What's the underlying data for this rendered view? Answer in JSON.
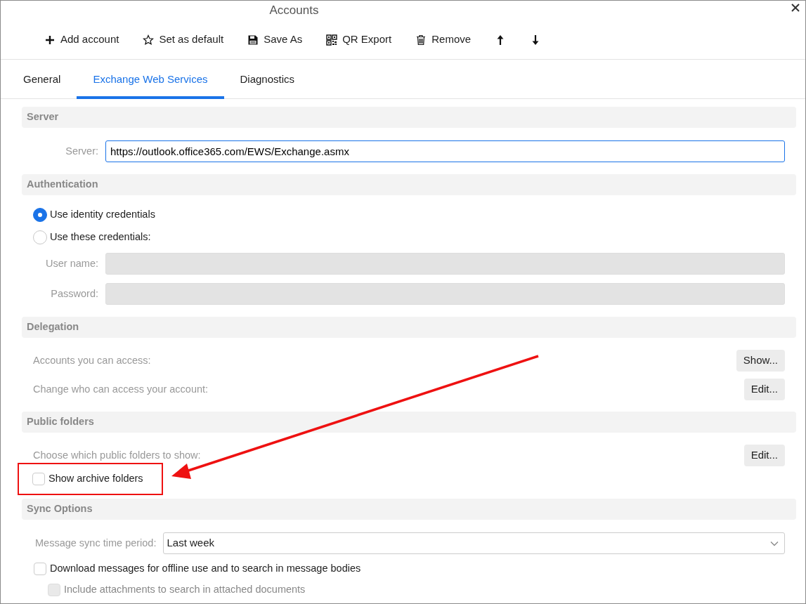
{
  "window": {
    "title": "Accounts"
  },
  "toolbar": [
    {
      "kind": "add",
      "label": "Add account"
    },
    {
      "kind": "default",
      "label": "Set as default"
    },
    {
      "kind": "save",
      "label": "Save As"
    },
    {
      "kind": "export",
      "label": "QR Export"
    },
    {
      "kind": "remove",
      "label": "Remove"
    },
    {
      "kind": "up"
    },
    {
      "kind": "down"
    }
  ],
  "tabs": [
    {
      "label": "General",
      "selected": false
    },
    {
      "label": "Exchange Web Services",
      "selected": true
    },
    {
      "label": "Diagnostics",
      "selected": false
    }
  ],
  "sections": [
    {
      "title": "Server",
      "rows": [
        {
          "kind": "field",
          "label": "Server:",
          "value": "https://outlook.office365.com/EWS/Exchange.asmx",
          "disabled": false,
          "focused": true
        }
      ]
    },
    {
      "title": "Authentication",
      "rows": [
        {
          "kind": "radio",
          "label": "Use identity credentials",
          "selected": true
        },
        {
          "kind": "radio",
          "label": "Use these credentials:",
          "selected": false
        },
        {
          "kind": "field",
          "label": "User name:",
          "disabled": true
        },
        {
          "kind": "field",
          "label": "Password:",
          "disabled": true
        }
      ]
    },
    {
      "title": "Delegation",
      "rows": [
        {
          "kind": "action",
          "label": "Accounts you can access:",
          "button": "Show..."
        },
        {
          "kind": "action",
          "label": "Change who can access your account:",
          "button": "Edit..."
        }
      ]
    },
    {
      "title": "Public folders",
      "rows": [
        {
          "kind": "action",
          "label": "Choose which public folders to show:",
          "button": "Edit..."
        },
        {
          "kind": "checkbox",
          "label": "Show archive folders",
          "checked": false,
          "disabled": false,
          "highlighted": true
        }
      ]
    },
    {
      "title": "Sync Options",
      "rows": [
        {
          "kind": "select",
          "label": "Message sync time period:",
          "value": "Last week"
        },
        {
          "kind": "checkbox",
          "label": "Download messages for offline use and to search in message bodies",
          "checked": false,
          "disabled": false,
          "children": [
            {
              "kind": "checkbox",
              "label": "Include attachments to search in attached documents",
              "checked": false,
              "disabled": true
            }
          ]
        }
      ]
    }
  ]
}
